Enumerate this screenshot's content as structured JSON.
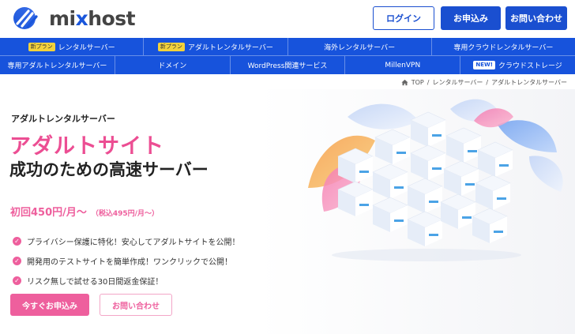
{
  "header": {
    "logo_text_a": "mi",
    "logo_text_x": "x",
    "logo_text_b": "host",
    "login_label": "ログイン",
    "apply_label": "お申込み",
    "contact_label": "お問い合わせ"
  },
  "nav": {
    "row1": [
      {
        "tag": "新プラン",
        "label": "レンタルサーバー"
      },
      {
        "tag": "新プラン",
        "label": "アダルトレンタルサーバー"
      },
      {
        "tag": "",
        "label": "海外レンタルサーバー"
      },
      {
        "tag": "",
        "label": "専用クラウドレンタルサーバー"
      }
    ],
    "row2": [
      {
        "tag": "",
        "label": "専用アダルトレンタルサーバー"
      },
      {
        "tag": "",
        "label": "ドメイン"
      },
      {
        "tag": "",
        "label": "WordPress関連サービス"
      },
      {
        "tag": "",
        "label": "MillenVPN"
      },
      {
        "tag": "NEW!",
        "label": "クラウドストレージ"
      }
    ]
  },
  "breadcrumb": {
    "items": [
      "TOP",
      "レンタルサーバー",
      "アダルトレンタルサーバー"
    ],
    "separator": "/"
  },
  "hero": {
    "eyebrow": "アダルトレンタルサーバー",
    "title_line1": "アダルトサイト",
    "title_line2": "成功のための高速サーバー",
    "price_main": "初回450円/月〜",
    "price_sub": "（税込495円/月〜）",
    "features": [
      "プライバシー保護に特化！安心してアダルトサイトを公開！",
      "開発用のテストサイトを簡単作成！ワンクリックで公開！",
      "リスク無しで試せる30日間返金保証！"
    ],
    "cta_primary": "今すぐお申込み",
    "cta_secondary": "お問い合わせ"
  },
  "colors": {
    "brand_blue": "#1753dc",
    "accent_pink": "#ee5f9d"
  }
}
